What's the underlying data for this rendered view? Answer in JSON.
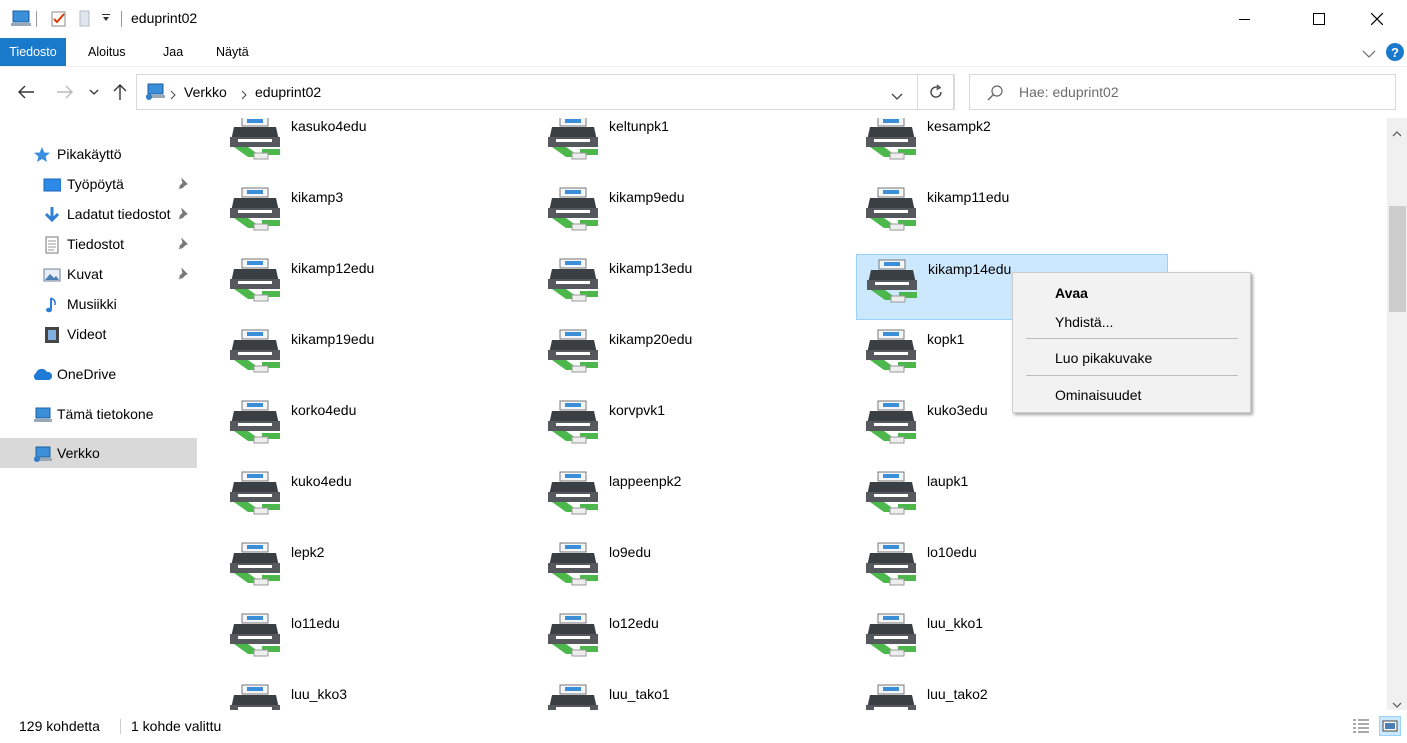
{
  "window": {
    "title": "eduprint02"
  },
  "ribbon": {
    "tabs": [
      "Tiedosto",
      "Aloitus",
      "Jaa",
      "Näytä"
    ]
  },
  "address": {
    "crumbs": [
      "Verkko",
      "eduprint02"
    ]
  },
  "search": {
    "placeholder": "Hae: eduprint02"
  },
  "sidebar": {
    "quick_access": "Pikakäyttö",
    "items": [
      {
        "label": "Työpöytä",
        "icon": "desktop-icon",
        "pinned": true
      },
      {
        "label": "Ladatut tiedostot",
        "icon": "download-icon",
        "pinned": true
      },
      {
        "label": "Tiedostot",
        "icon": "documents-icon",
        "pinned": true
      },
      {
        "label": "Kuvat",
        "icon": "pictures-icon",
        "pinned": true
      },
      {
        "label": "Musiikki",
        "icon": "music-icon",
        "pinned": false
      },
      {
        "label": "Videot",
        "icon": "videos-icon",
        "pinned": false
      }
    ],
    "onedrive": "OneDrive",
    "this_pc": "Tämä tietokone",
    "network": "Verkko"
  },
  "printers": [
    "kasuko4edu",
    "keltunpk1",
    "kesampk2",
    "kikamp3",
    "kikamp9edu",
    "kikamp11edu",
    "kikamp12edu",
    "kikamp13edu",
    "kikamp14edu",
    "kikamp19edu",
    "kikamp20edu",
    "kopk1",
    "korko4edu",
    "korvpvk1",
    "kuko3edu",
    "kuko4edu",
    "lappeenpk2",
    "laupk1",
    "lepk2",
    "lo9edu",
    "lo10edu",
    "lo11edu",
    "lo12edu",
    "luu_kko1",
    "luu_kko3",
    "luu_tako1",
    "luu_tako2"
  ],
  "selected_printer": "kikamp14edu",
  "context_menu": {
    "open": "Avaa",
    "connect": "Yhdistä...",
    "create_shortcut": "Luo pikakuvake",
    "properties": "Ominaisuudet"
  },
  "status": {
    "count": "129 kohdetta",
    "selected": "1 kohde valittu"
  },
  "colors": {
    "accent": "#1979ca",
    "selection": "#cce8ff",
    "printer_green": "#4cb84c"
  }
}
